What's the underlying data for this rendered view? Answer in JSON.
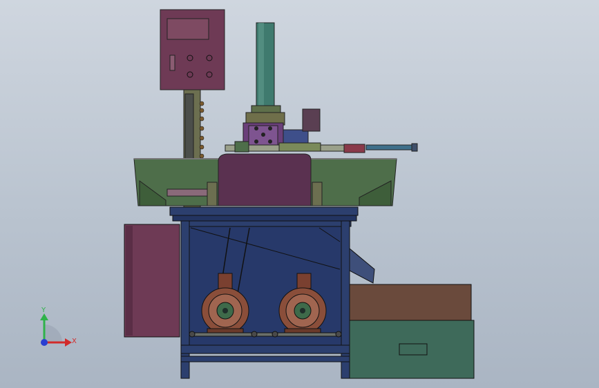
{
  "triad": {
    "y_label": "Y",
    "x_label": "X",
    "y_color": "#2fb24a",
    "x_color": "#d22a2a",
    "z_color": "#2a3fd2"
  },
  "colors": {
    "cabinet": "#6e3a55",
    "frame": "#2c3f6e",
    "tray": "#4e6e4a",
    "cylinder": "#3f7a6e",
    "motor": "#8a4e3a",
    "hopper_top": "#6a4a3c",
    "hopper_bottom": "#3e6a5a"
  }
}
